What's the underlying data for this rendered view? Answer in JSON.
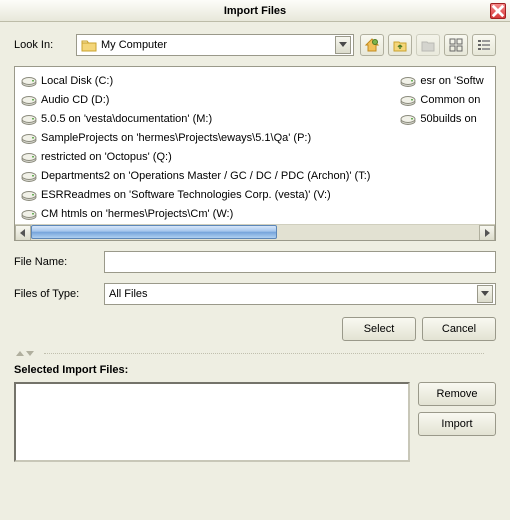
{
  "title": "Import Files",
  "lookin_label": "Look In:",
  "lookin_value": "My Computer",
  "filename_label": "File Name:",
  "filename_value": "",
  "filetype_label": "Files of Type:",
  "filetype_value": "All Files",
  "select_label": "Select",
  "cancel_label": "Cancel",
  "selected_heading": "Selected Import Files:",
  "remove_label": "Remove",
  "import_label": "Import",
  "files_col1": [
    "Local Disk (C:)",
    "Audio CD (D:)",
    "5.0.5 on 'vesta\\documentation' (M:)",
    "SampleProjects on 'hermes\\Projects\\eways\\5.1\\Qa' (P:)",
    "restricted on 'Octopus' (Q:)",
    "Departments2 on 'Operations Master / GC / DC / PDC (Archon)' (T:)",
    "ESRReadmes on 'Software Technologies Corp. (vesta)' (V:)",
    "CM htmls on 'hermes\\Projects\\Cm' (W:)"
  ],
  "files_col2": [
    "esr on 'Softw",
    "Common on",
    "50builds on"
  ],
  "toolbar": {
    "home_name": "home-icon",
    "up_name": "up-folder-icon",
    "newfolder_name": "new-folder-icon",
    "list_name": "list-view-icon",
    "details_name": "details-view-icon"
  }
}
